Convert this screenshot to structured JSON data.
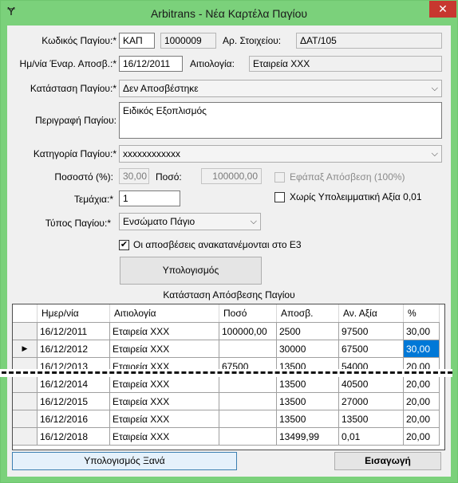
{
  "window": {
    "title": "Arbitrans - Νέα Καρτέλα Παγίου",
    "close_glyph": "✕",
    "app_icon_glyph": "Ɏ"
  },
  "form": {
    "code_label": "Κωδικός Παγίου:*",
    "code_prefix": "ΚΑΠ",
    "code_number": "1000009",
    "doc_label": "Αρ. Στοιχείου:",
    "doc_value": "ΔΑΤ/105",
    "date_label": "Ημ/νία Έναρ. Αποσβ.:*",
    "date_value": "16/12/2011",
    "reason_label": "Αιτιολογία:",
    "reason_value": "Εταιρεία ΧΧΧ",
    "status_label": "Κατάσταση Παγίου:*",
    "status_value": "Δεν Αποσβέστηκε",
    "desc_label": "Περιγραφή Παγίου:",
    "desc_value": "Ειδικός Εξοπλισμός",
    "category_label": "Κατηγορία Παγίου:*",
    "category_value": "xxxxxxxxxxxx",
    "percent_label": "Ποσοστό (%):",
    "percent_value": "30,00",
    "amount_label": "Ποσό:",
    "amount_value": "100000,00",
    "onetime_label": "Εφάπαξ Απόσβεση (100%)",
    "pieces_label": "Τεμάχια:*",
    "pieces_value": "1",
    "no_residual_label": "Χωρίς Υπολειμματική Αξία 0,01",
    "type_label": "Τύπος Παγίου:*",
    "type_value": "Ενσώματο Πάγιο",
    "e3_label": "Οι αποσβέσεις ανακατανέμονται στο Ε3",
    "e3_checked": "✔",
    "calculate_button": "Υπολογισμός",
    "grid_title": "Κατάσταση Απόσβεσης Παγίου",
    "recalc_button": "Υπολογισμός Ξανά",
    "insert_button": "Εισαγωγή"
  },
  "grid": {
    "headers": [
      "Ημερ/νία",
      "Αιτιολογία",
      "Ποσό",
      "Αποσβ.",
      "Αν. Αξία",
      "%"
    ],
    "rows": [
      [
        "16/12/2011",
        "Εταιρεία ΧΧΧ",
        "100000,00",
        "2500",
        "97500",
        "30,00"
      ],
      [
        "16/12/2012",
        "Εταιρεία ΧΧΧ",
        "",
        "30000",
        "67500",
        "30,00"
      ],
      [
        "16/12/2013",
        "Εταιρεία ΧΧΧ",
        "67500",
        "13500",
        "54000",
        "20,00"
      ],
      [
        "16/12/2014",
        "Εταιρεία ΧΧΧ",
        "",
        "13500",
        "40500",
        "20,00"
      ],
      [
        "16/12/2015",
        "Εταιρεία ΧΧΧ",
        "",
        "13500",
        "27000",
        "20,00"
      ],
      [
        "16/12/2016",
        "Εταιρεία ΧΧΧ",
        "",
        "13500",
        "13500",
        "20,00"
      ],
      [
        "16/12/2018",
        "Εταιρεία ΧΧΧ",
        "",
        "13499,99",
        "0,01",
        "20,00"
      ]
    ],
    "current_row_marker": "▶"
  }
}
